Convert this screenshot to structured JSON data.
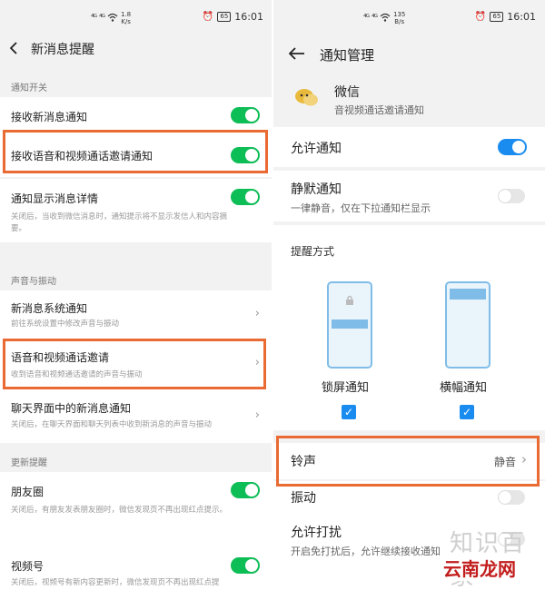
{
  "colors": {
    "toggle_on_green": "#0dbd56",
    "toggle_on_blue": "#1a8cf0",
    "highlight": "#ea6a33"
  },
  "left": {
    "status": {
      "signal1": "⁴ᴳ",
      "signal2": "⁴ᴳ",
      "speed_value": "1.8",
      "speed_unit": "K/s",
      "battery": "65",
      "time": "16:01"
    },
    "header": {
      "title": "新消息提醒"
    },
    "sections": {
      "notify_label": "通知开关",
      "sound_label": "声音与振动",
      "update_label": "更新提醒"
    },
    "items": {
      "receive": {
        "title": "接收新消息通知"
      },
      "call": {
        "title": "接收语音和视频通话邀请通知"
      },
      "detail": {
        "title": "通知显示消息详情",
        "sub": "关闭后，当收到微信消息时，通知提示将不显示发信人和内容摘要。"
      },
      "system": {
        "title": "新消息系统通知",
        "sub": "前往系统设置中修改声音与振动"
      },
      "voice": {
        "title": "语音和视频通话邀请",
        "sub": "收到语音和视频通话邀请的声音与振动"
      },
      "chat": {
        "title": "聊天界面中的新消息通知",
        "sub": "关闭后，在聊天界面和聊天列表中收到新消息的声音与振动"
      },
      "moments": {
        "title": "朋友圈",
        "sub": "关闭后，有朋友发表朋友圈时，微信发现页不再出现红点提示。"
      },
      "channels": {
        "title": "视频号",
        "sub": "关闭后，视频号有新内容更新时，微信发现页不再出现红点提"
      }
    }
  },
  "right": {
    "status": {
      "signal1": "⁴ᴳ",
      "signal2": "⁴ᴳ",
      "speed_value": "135",
      "speed_unit": "B/s",
      "battery": "65",
      "time": "16:01"
    },
    "header": {
      "title": "通知管理"
    },
    "app": {
      "name": "微信",
      "desc": "音视频通话邀请通知"
    },
    "allow": {
      "title": "允许通知"
    },
    "silent": {
      "title": "静默通知",
      "sub": "一律静音，仅在下拉通知栏显示"
    },
    "remind_label": "提醒方式",
    "lock_label": "锁屏通知",
    "banner_label": "横幅通知",
    "ringtone": {
      "title": "铃声",
      "value": "静音"
    },
    "vibrate": {
      "title": "振动"
    },
    "dnd": {
      "title": "允许打扰",
      "sub": "开启免打扰后，允许继续接收通知"
    },
    "watermark": "知识百家",
    "watermark_tag": "云南龙网"
  }
}
